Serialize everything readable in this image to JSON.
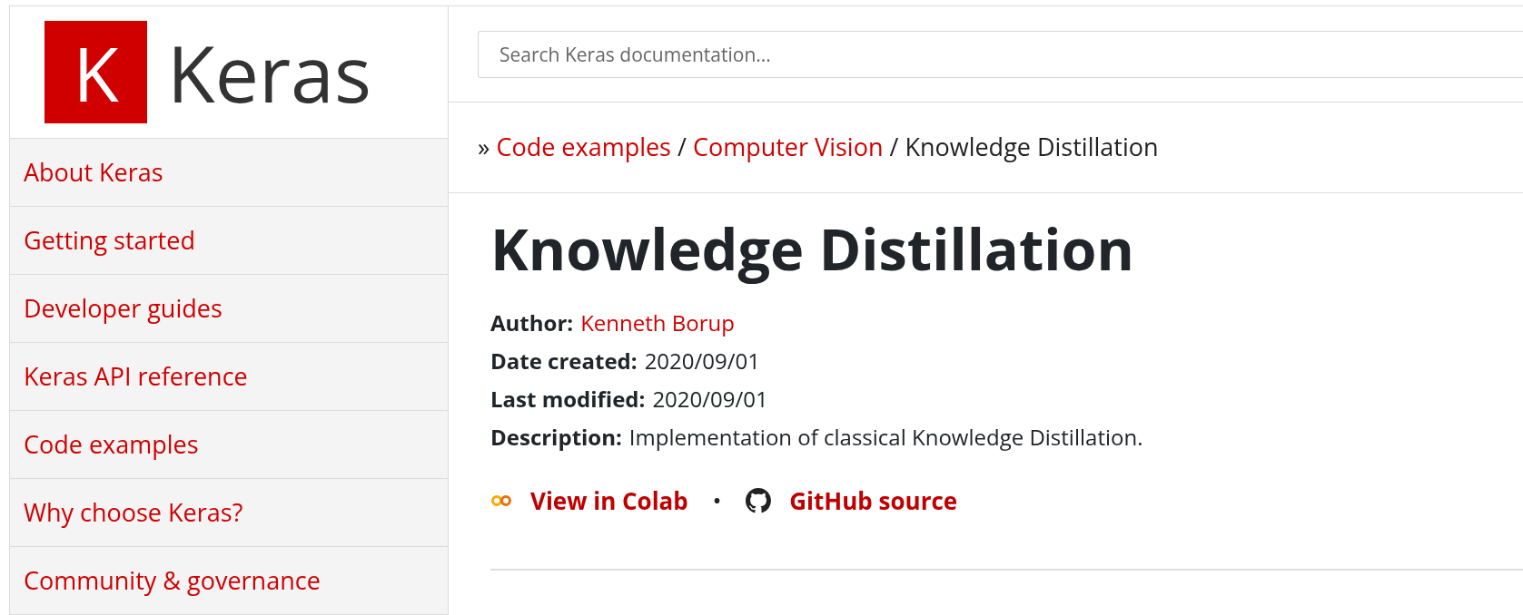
{
  "logo": {
    "letter": "K",
    "name": "Keras"
  },
  "sidebar": {
    "items": [
      {
        "label": "About Keras"
      },
      {
        "label": "Getting started"
      },
      {
        "label": "Developer guides"
      },
      {
        "label": "Keras API reference"
      },
      {
        "label": "Code examples"
      },
      {
        "label": "Why choose Keras?"
      },
      {
        "label": "Community & governance"
      }
    ]
  },
  "search": {
    "placeholder": "Search Keras documentation..."
  },
  "breadcrumb": {
    "prefix": "»",
    "links": [
      "Code examples",
      "Computer Vision"
    ],
    "current": "Knowledge Distillation",
    "separator": "/"
  },
  "title": "Knowledge Distillation",
  "meta": [
    {
      "label": "Author:",
      "value": "Kenneth Borup",
      "kind": "link"
    },
    {
      "label": "Date created:",
      "value": "2020/09/01",
      "kind": "text"
    },
    {
      "label": "Last modified:",
      "value": "2020/09/01",
      "kind": "text"
    },
    {
      "label": "Description:",
      "value": "Implementation of classical Knowledge Distillation.",
      "kind": "text"
    }
  ],
  "source_links": [
    {
      "label": "View in Colab",
      "kind": "colab"
    },
    {
      "label": "GitHub source",
      "kind": "github"
    }
  ],
  "link_separator": "•"
}
